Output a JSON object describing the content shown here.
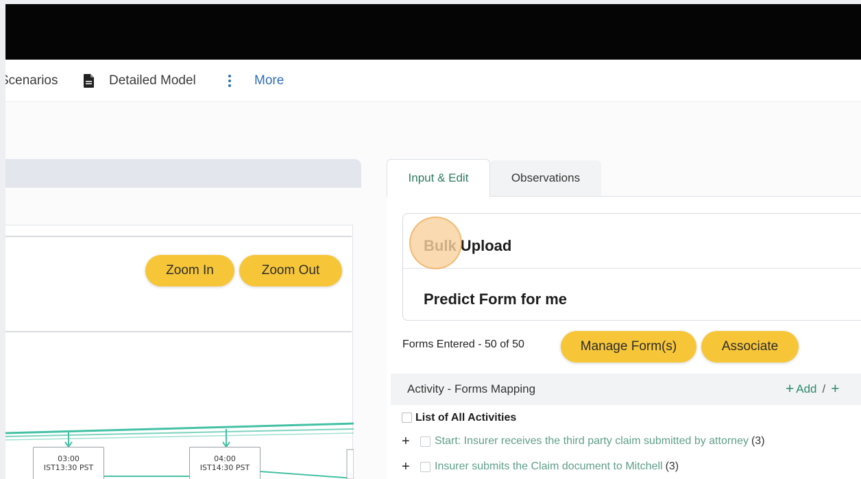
{
  "nav": {
    "items": [
      {
        "label": "Scenarios",
        "icon": ""
      },
      {
        "label": "Detailed Model",
        "icon": "document-icon"
      },
      {
        "label": "More",
        "icon": "kebab-menu-icon"
      }
    ]
  },
  "diagram": {
    "zoom_in_label": "Zoom In",
    "zoom_out_label": "Zoom Out",
    "nodes": [
      {
        "time": "03:00",
        "tz": "IST13:30 PST"
      },
      {
        "time": "04:00",
        "tz": "IST14:30 PST"
      }
    ]
  },
  "tabs": {
    "input_edit": "Input & Edit",
    "observations": "Observations"
  },
  "options": {
    "bulk_upload_faded": "Bulk",
    "bulk_upload_rest": " Upload",
    "predict_form": "Predict Form for me"
  },
  "forms": {
    "entered_text": "Forms Entered - 50 of 50",
    "manage_label": "Manage Form(s)",
    "associate_label": "Associate"
  },
  "mapping": {
    "title": "Activity - Forms Mapping",
    "add_label": "Add",
    "add_separator": "/",
    "list_all": "List of All Activities",
    "activities": [
      {
        "label": "Start: Insurer receives the third party claim submitted by attorney",
        "count": "(3)"
      },
      {
        "label": "Insurer submits the Claim document to Mitchell",
        "count": "(3)"
      }
    ]
  },
  "colors": {
    "accent_yellow": "#f7c638",
    "tab_green": "#2a7a60",
    "link_blue": "#2f6fb8",
    "flow_teal": "#43c1a4"
  }
}
